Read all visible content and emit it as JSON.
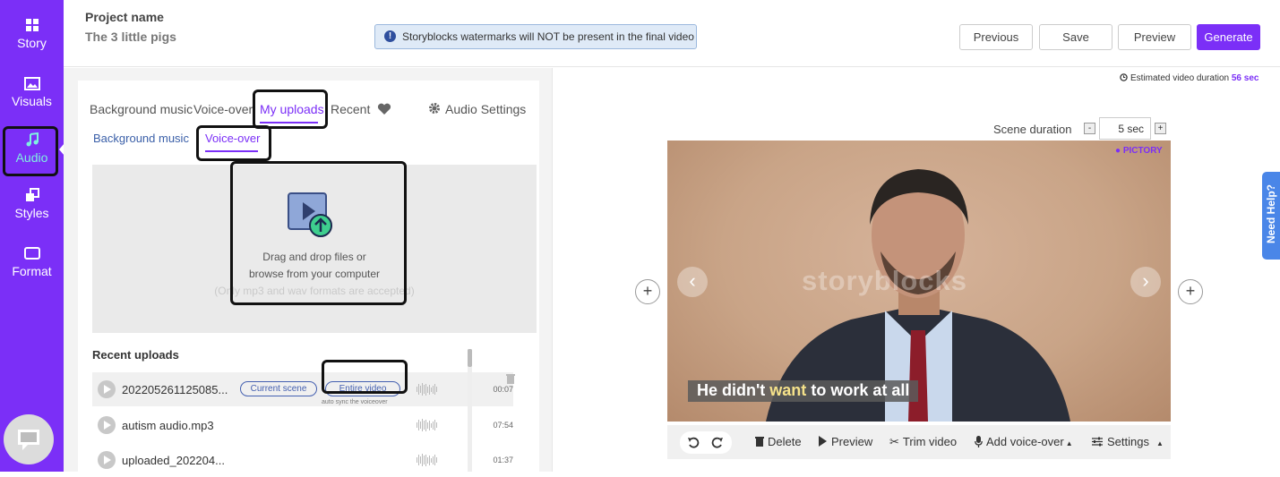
{
  "sidebar": {
    "items": [
      {
        "label": "Story",
        "icon": "grid-icon"
      },
      {
        "label": "Visuals",
        "icon": "image-icon"
      },
      {
        "label": "Audio",
        "icon": "music-note-icon"
      },
      {
        "label": "Styles",
        "icon": "styles-icon"
      },
      {
        "label": "Format",
        "icon": "format-icon"
      }
    ],
    "active": "Audio",
    "active_color": "#7ef0e0",
    "bg_color": "#7b2ff7"
  },
  "header": {
    "project_label": "Project name",
    "project_name": "The 3 little pigs",
    "notice": "Storyblocks watermarks will NOT be present in the final video",
    "buttons": {
      "previous": "Previous",
      "save": "Save",
      "preview": "Preview",
      "generate": "Generate"
    },
    "accent": "#7b2ff7"
  },
  "audio_panel": {
    "tabs": [
      "Background music",
      "Voice-over",
      "My uploads",
      "Recent"
    ],
    "active_tab": "My uploads",
    "favorites_icon": "heart-icon",
    "settings_label": "Audio Settings",
    "subtabs": [
      "Background music",
      "Voice-over"
    ],
    "active_subtab": "Voice-over",
    "dropzone": {
      "line1": "Drag and drop files or",
      "line2": "browse from your computer",
      "hint": "(Only mp3 and wav formats are accepted)"
    },
    "recent_title": "Recent uploads",
    "uploads": [
      {
        "name": "202205261125085...",
        "duration": "00:07",
        "btn_current": "Current scene",
        "btn_entire": "Entire video",
        "sync_note": "auto sync the voiceover"
      },
      {
        "name": "autism audio.mp3",
        "duration": "07:54"
      },
      {
        "name": "uploaded_202204...",
        "duration": "01:37"
      }
    ]
  },
  "preview": {
    "estimated_label": "Estimated video duration",
    "estimated_value": "56 sec",
    "scene_duration_label": "Scene duration",
    "scene_duration_value": "5 sec",
    "minus": "-",
    "plus": "+",
    "brand": "PICTORY",
    "watermark": "storyblocks",
    "caption_pre": "He didn't",
    "caption_em": "want",
    "caption_post": "to work at all",
    "toolbar": {
      "delete": "Delete",
      "preview": "Preview",
      "trim": "Trim video",
      "add_voiceover": "Add voice-over",
      "settings": "Settings"
    },
    "need_help": "Need Help?"
  }
}
